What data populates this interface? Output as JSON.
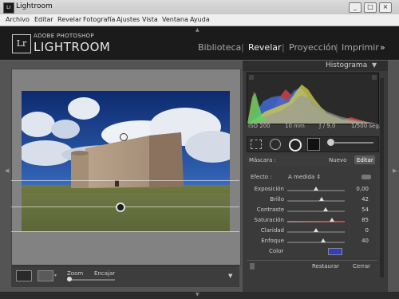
{
  "window": {
    "title": "Lightroom",
    "app_icon": "Lr",
    "minimize": "_",
    "maximize": "□",
    "close": "×"
  },
  "menu": [
    "Archivo",
    "Editar",
    "Revelar",
    "Fotografía",
    "Ajustes",
    "Vista",
    "Ventana",
    "Ayuda"
  ],
  "identity": {
    "logo": "Lr",
    "brand_small": "ADOBE PHOTOSHOP",
    "brand_large": "LIGHTROOM"
  },
  "modules": {
    "items": [
      "Biblioteca",
      "Revelar",
      "Proyección",
      "Imprimir"
    ],
    "active": "Revelar",
    "more": "»"
  },
  "panel": {
    "title": "Histograma",
    "collapse_icon": "▼",
    "info": {
      "iso": "ISO 200",
      "focal": "10 mm",
      "aperture": "ƒ / 9,0",
      "shutter": "1/500 seg."
    },
    "mask_label": "Máscara :",
    "mask_new": "Nuevo",
    "mask_edit": "Editar",
    "effect_label": "Efecto :",
    "effect_value": "A medida ⇕",
    "sliders": [
      {
        "name": "Exposición",
        "value": "0,00",
        "pos": 0.5
      },
      {
        "name": "Brillo",
        "value": "42",
        "pos": 0.6
      },
      {
        "name": "Contraste",
        "value": "54",
        "pos": 0.66
      },
      {
        "name": "Saturación",
        "value": "85",
        "pos": 0.78
      },
      {
        "name": "Claridad",
        "value": "0",
        "pos": 0.5
      },
      {
        "name": "Enfoque",
        "value": "40",
        "pos": 0.62
      }
    ],
    "color_label": "Color",
    "color_swatch": "#2e3fbf",
    "reset": "Restaurar",
    "close": "Cerrar"
  },
  "toolbar": {
    "zoom_label": "Zoom",
    "fit_label": "Encajar"
  },
  "colors": {
    "accent": "#d8d8d8",
    "panel": "#3a3a3a",
    "identity": "#1b1b1b"
  }
}
